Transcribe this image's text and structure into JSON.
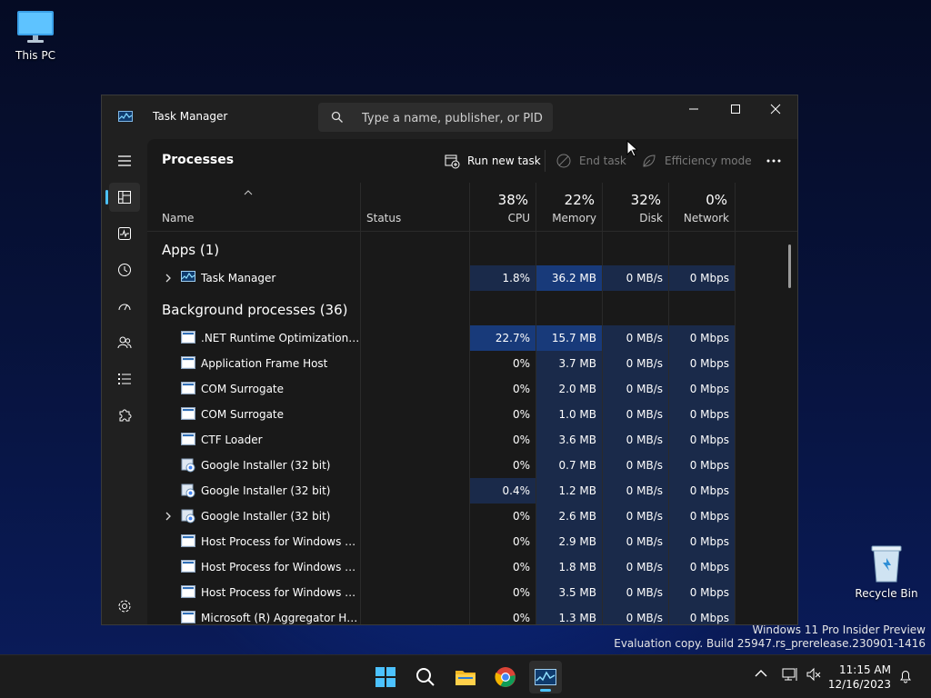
{
  "desktop": {
    "this_pc_label": "This PC",
    "recycle_bin_label": "Recycle Bin",
    "watermark_line1": "Windows 11 Pro Insider Preview",
    "watermark_line2": "Evaluation copy. Build 25947.rs_prerelease.230901-1416"
  },
  "window": {
    "title": "Task Manager",
    "search_placeholder": "Type a name, publisher, or PID..."
  },
  "nav": {
    "icons": [
      "hamburger-icon",
      "processes-icon",
      "performance-icon",
      "app-history-icon",
      "startup-apps-icon",
      "users-icon",
      "details-icon",
      "services-icon",
      "settings-icon"
    ],
    "active": "processes-icon"
  },
  "toolbar": {
    "page_title": "Processes",
    "run_new_task": "Run new task",
    "end_task": "End task",
    "efficiency_mode": "Efficiency mode",
    "more": "..."
  },
  "columns": {
    "name": "Name",
    "status": "Status",
    "cpu": {
      "pct": "38%",
      "label": "CPU"
    },
    "memory": {
      "pct": "22%",
      "label": "Memory"
    },
    "disk": {
      "pct": "32%",
      "label": "Disk"
    },
    "network": {
      "pct": "0%",
      "label": "Network"
    }
  },
  "groups": {
    "apps": "Apps (1)",
    "background": "Background processes (36)"
  },
  "apps": [
    {
      "name": "Task Manager",
      "expandable": true,
      "icon": "taskmanager-icon",
      "cpu": "1.8%",
      "memory": "36.2 MB",
      "disk": "0 MB/s",
      "network": "0 Mbps"
    }
  ],
  "background": [
    {
      "name": ".NET Runtime Optimization Se...",
      "expandable": false,
      "icon": "process-icon",
      "cpu": "22.7%",
      "memory": "15.7 MB",
      "disk": "0 MB/s",
      "network": "0 Mbps"
    },
    {
      "name": "Application Frame Host",
      "expandable": false,
      "icon": "process-icon",
      "cpu": "0%",
      "memory": "3.7 MB",
      "disk": "0 MB/s",
      "network": "0 Mbps"
    },
    {
      "name": "COM Surrogate",
      "expandable": false,
      "icon": "process-icon",
      "cpu": "0%",
      "memory": "2.0 MB",
      "disk": "0 MB/s",
      "network": "0 Mbps"
    },
    {
      "name": "COM Surrogate",
      "expandable": false,
      "icon": "process-icon",
      "cpu": "0%",
      "memory": "1.0 MB",
      "disk": "0 MB/s",
      "network": "0 Mbps"
    },
    {
      "name": "CTF Loader",
      "expandable": false,
      "icon": "process-icon",
      "cpu": "0%",
      "memory": "3.6 MB",
      "disk": "0 MB/s",
      "network": "0 Mbps"
    },
    {
      "name": "Google Installer (32 bit)",
      "expandable": false,
      "icon": "installer-icon",
      "cpu": "0%",
      "memory": "0.7 MB",
      "disk": "0 MB/s",
      "network": "0 Mbps"
    },
    {
      "name": "Google Installer (32 bit)",
      "expandable": false,
      "icon": "installer-icon",
      "cpu": "0.4%",
      "memory": "1.2 MB",
      "disk": "0 MB/s",
      "network": "0 Mbps"
    },
    {
      "name": "Google Installer (32 bit)",
      "expandable": true,
      "icon": "installer-icon",
      "cpu": "0%",
      "memory": "2.6 MB",
      "disk": "0 MB/s",
      "network": "0 Mbps"
    },
    {
      "name": "Host Process for Windows Tasks",
      "expandable": false,
      "icon": "process-icon",
      "cpu": "0%",
      "memory": "2.9 MB",
      "disk": "0 MB/s",
      "network": "0 Mbps"
    },
    {
      "name": "Host Process for Windows Tasks",
      "expandable": false,
      "icon": "process-icon",
      "cpu": "0%",
      "memory": "1.8 MB",
      "disk": "0 MB/s",
      "network": "0 Mbps"
    },
    {
      "name": "Host Process for Windows Tasks",
      "expandable": false,
      "icon": "process-icon",
      "cpu": "0%",
      "memory": "3.5 MB",
      "disk": "0 MB/s",
      "network": "0 Mbps"
    },
    {
      "name": "Microsoft (R) Aggregator Host",
      "expandable": false,
      "icon": "process-icon",
      "cpu": "0%",
      "memory": "1.3 MB",
      "disk": "0 MB/s",
      "network": "0 Mbps"
    }
  ],
  "taskbar": {
    "apps": [
      "start-icon",
      "search-icon",
      "file-explorer-icon",
      "chrome-icon",
      "task-manager-icon"
    ],
    "active_app": "task-manager-icon",
    "time": "11:15 AM",
    "date": "12/16/2023"
  },
  "colors": {
    "accent": "#4cc2ff",
    "heat_low": "#1a2a4a",
    "heat_high": "#183a7a"
  }
}
